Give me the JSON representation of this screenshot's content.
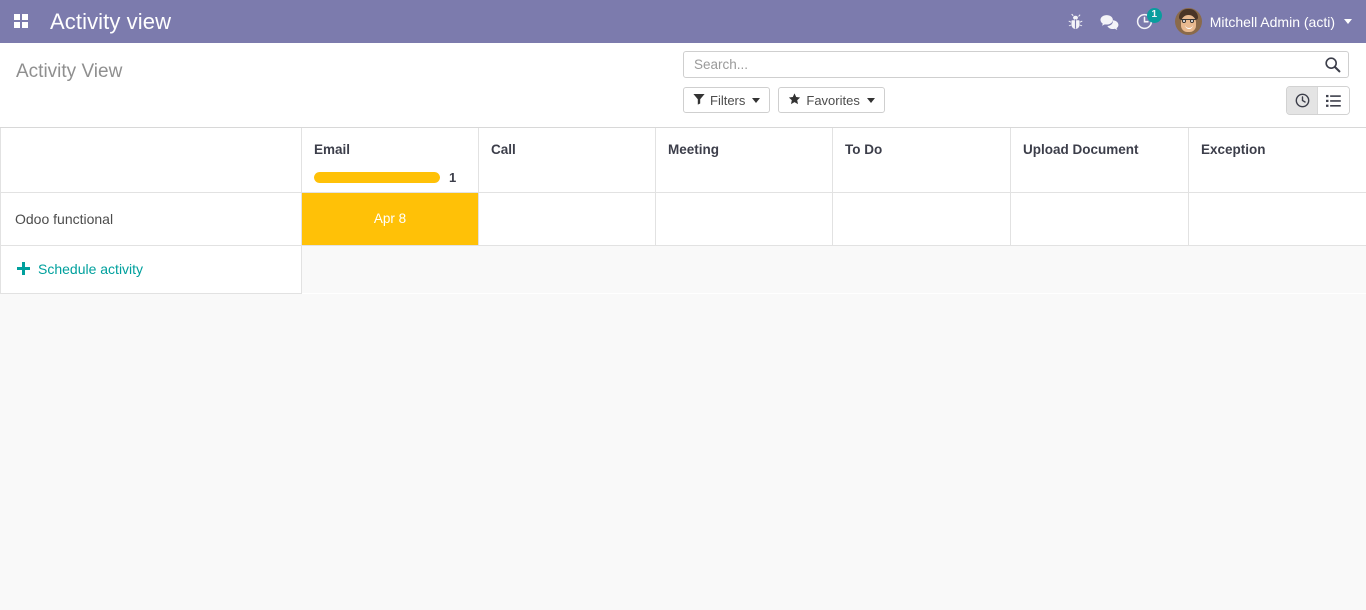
{
  "navbar": {
    "apps_icon": "apps-grid-icon",
    "title": "Activity view",
    "bug_icon": "bug-icon",
    "messages_icon": "chat-bubble-icon",
    "activities_icon": "clock-icon",
    "activities_count": "1",
    "user_name": "Mitchell Admin (acti)"
  },
  "control_panel": {
    "breadcrumb": "Activity View",
    "search": {
      "placeholder": "Search...",
      "value": "",
      "icon": "search-icon"
    },
    "filters_label": "Filters",
    "filters_icon": "funnel-icon",
    "favorites_label": "Favorites",
    "favorites_icon": "star-icon",
    "views": [
      {
        "name": "activity",
        "icon": "clock-icon",
        "active": true
      },
      {
        "name": "list",
        "icon": "list-icon",
        "active": false
      }
    ]
  },
  "activity_table": {
    "columns": [
      {
        "label": "Email",
        "count": "1",
        "progress_percent": 100
      },
      {
        "label": "Call",
        "count": "",
        "progress_percent": 0
      },
      {
        "label": "Meeting",
        "count": "",
        "progress_percent": 0
      },
      {
        "label": "To Do",
        "count": "",
        "progress_percent": 0
      },
      {
        "label": "Upload Document",
        "count": "",
        "progress_percent": 0
      },
      {
        "label": "Exception",
        "count": "",
        "progress_percent": 0
      }
    ],
    "rows": [
      {
        "name": "Odoo functional",
        "cells": [
          {
            "label": "Apr 8",
            "state": "planned"
          },
          {
            "label": "",
            "state": "empty"
          },
          {
            "label": "",
            "state": "empty"
          },
          {
            "label": "",
            "state": "empty"
          },
          {
            "label": "",
            "state": "empty"
          },
          {
            "label": "",
            "state": "empty"
          }
        ]
      }
    ],
    "schedule_label": "Schedule activity",
    "schedule_icon": "plus-icon"
  },
  "colors": {
    "brand_purple": "#7c7bad",
    "activity_amber": "#ffc107",
    "accent_teal": "#00a09d",
    "page_background": "#f9f9f9"
  }
}
